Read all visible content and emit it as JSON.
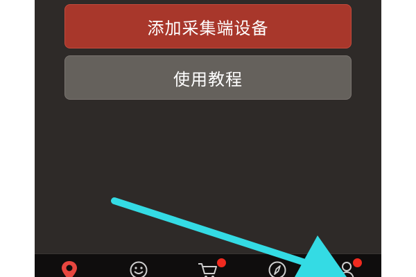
{
  "colors": {
    "screen_bg": "#2e2a28",
    "primary_button": "#a8372b",
    "secondary_button": "#65615c",
    "tabbar_bg": "#0f0d0d",
    "tab_active": "#e7463f",
    "tab_inactive": "#cfcfcf",
    "badge": "#f02a1f",
    "annotation_arrow": "#34dbe4"
  },
  "actions": {
    "add_device_label": "添加采集端设备",
    "tutorial_label": "使用教程"
  },
  "tabbar": {
    "tabs": [
      {
        "icon": "location-pin-icon",
        "active": true,
        "badge": false
      },
      {
        "icon": "smiley-face-icon",
        "active": false,
        "badge": false
      },
      {
        "icon": "shopping-cart-icon",
        "active": false,
        "badge": true
      },
      {
        "icon": "compass-icon",
        "active": false,
        "badge": false
      },
      {
        "icon": "user-profile-icon",
        "active": false,
        "badge": true
      }
    ]
  },
  "annotation": {
    "icon": "pointer-arrow-icon",
    "target": "user-profile-icon"
  }
}
